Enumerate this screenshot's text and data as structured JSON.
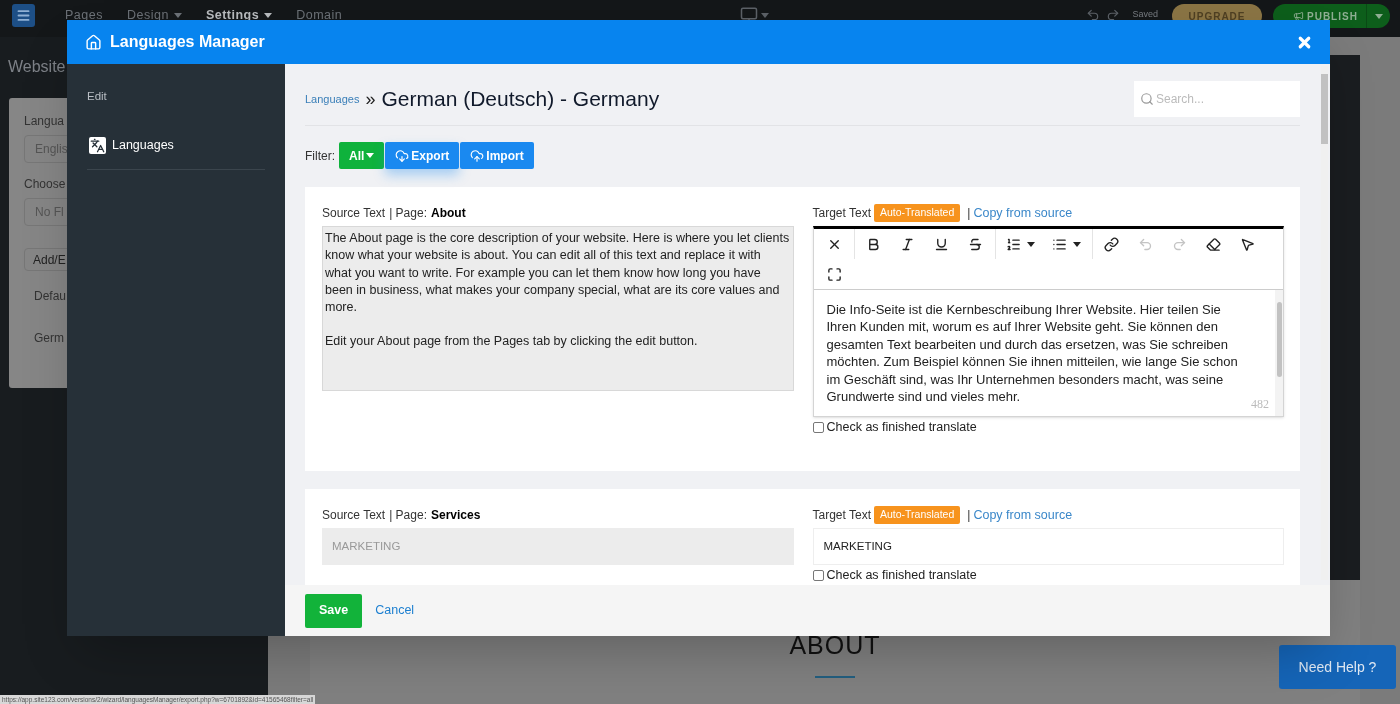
{
  "app_bar": {
    "nav": [
      {
        "label": "Pages",
        "selected": false,
        "dropdown": false
      },
      {
        "label": "Design",
        "selected": false,
        "dropdown": true
      },
      {
        "label": "Settings",
        "selected": true,
        "dropdown": true
      },
      {
        "label": "Domain",
        "selected": false,
        "dropdown": false
      }
    ],
    "status": "Saved",
    "upgrade": "UPGRADE",
    "publish": "PUBLISH"
  },
  "background_panel": {
    "title": "Website",
    "items": [
      {
        "kind": "label",
        "text": "Langua"
      },
      {
        "kind": "field",
        "text": "Englis"
      },
      {
        "kind": "label",
        "text": "Choose"
      },
      {
        "kind": "field",
        "text": "No Fl"
      },
      {
        "kind": "button",
        "text": "Add/E"
      },
      {
        "kind": "item",
        "text": "Defau"
      },
      {
        "kind": "item",
        "text": "Germ"
      }
    ]
  },
  "preview": {
    "heading": "ABOUT"
  },
  "help_button": "Need Help ?",
  "status_url": "https://app.site123.com/versions/2/wizard/languagesManager/export.php?w=6701892&id=41565468filter=all",
  "modal": {
    "title": "Languages Manager",
    "sidebar": {
      "heading": "Edit",
      "items": [
        {
          "label": "Languages",
          "selected": true
        }
      ]
    },
    "breadcrumb": {
      "link": "Languages",
      "separator": "»",
      "title": "German (Deutsch) - Germany"
    },
    "search": {
      "placeholder": "Search..."
    },
    "filter": {
      "label": "Filter:",
      "buttons": [
        {
          "label": "All",
          "kind": "dropdown"
        },
        {
          "label": "Export",
          "kind": "export"
        },
        {
          "label": "Import",
          "kind": "import"
        }
      ]
    },
    "entries": [
      {
        "source_label": "Source Text",
        "page_label": "| Page:",
        "page": "About",
        "source_paragraphs": [
          "The About page is the core description of your website. Here is where you let clients know what your website is about. You can edit all of this text and replace it with what you want to write. For example you can let them know how long you have been in business, what makes your company special, what are its core values and more.",
          "Edit your About page from the Pages tab by clicking the edit button."
        ],
        "target_label": "Target Text",
        "badge": "Auto-Translated",
        "divider": "|",
        "copy_link": "Copy from source",
        "kind": "rich",
        "toolbar": [
          [
            {
              "kind": "clear",
              "disabled": false
            }
          ],
          [
            {
              "kind": "bold",
              "disabled": false
            },
            {
              "kind": "italic",
              "disabled": false
            },
            {
              "kind": "underline",
              "disabled": false
            },
            {
              "kind": "strike",
              "disabled": false
            }
          ],
          [
            {
              "kind": "ordered-list",
              "disabled": false
            },
            {
              "kind": "bullet-list",
              "disabled": false
            }
          ],
          [
            {
              "kind": "link",
              "disabled": false
            },
            {
              "kind": "undo",
              "disabled": true
            },
            {
              "kind": "redo",
              "disabled": true
            },
            {
              "kind": "eraser",
              "disabled": false
            },
            {
              "kind": "pointer",
              "disabled": false
            }
          ]
        ],
        "toolbar_row2": [
          {
            "kind": "fullscreen",
            "disabled": false
          }
        ],
        "target_text": "Die Info-Seite ist die Kernbeschreibung Ihrer Website. Hier teilen Sie Ihren Kunden mit, worum es auf Ihrer Website geht. Sie können den gesamten Text bearbeiten und durch das ersetzen, was Sie schreiben möchten. Zum Beispiel können Sie ihnen mitteilen, wie lange Sie schon im Geschäft sind, was Ihr Unternehmen besonders macht, was seine Grundwerte sind und vieles mehr.",
        "char_count": "482",
        "finished": {
          "label": "Check as finished translate",
          "checked": false
        }
      },
      {
        "source_label": "Source Text",
        "page_label": "| Page:",
        "page": "Services",
        "source_paragraphs": [
          "MARKETING"
        ],
        "target_label": "Target Text",
        "badge": "Auto-Translated",
        "divider": "|",
        "copy_link": "Copy from source",
        "kind": "plain",
        "target_text": "MARKETING",
        "finished": {
          "label": "Check as finished translate",
          "checked": false
        }
      }
    ],
    "footer": {
      "save": "Save",
      "cancel": "Cancel"
    }
  }
}
